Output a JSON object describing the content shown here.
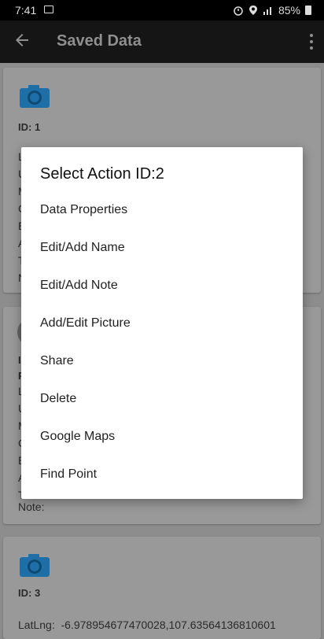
{
  "status_bar": {
    "time": "7:41",
    "battery": "85%"
  },
  "app_bar": {
    "title": "Saved Data"
  },
  "cards": [
    {
      "id_label": "ID: 1"
    },
    {
      "id_label_fragment": "I",
      "p_fragment": "P",
      "note_label": "Note:"
    },
    {
      "id_label": "ID: 3",
      "latlng_label": "LatLng:",
      "latlng_value": "-6.978954677470028,107.63564136810601"
    }
  ],
  "card1_fragments": [
    "L",
    "U",
    "M",
    "C",
    "E",
    "A",
    "T",
    "N"
  ],
  "card2_fragments": [
    "L",
    "U",
    "M",
    "C",
    "E",
    "A",
    "T"
  ],
  "dialog": {
    "title": "Select Action ID:2",
    "items": [
      "Data Properties",
      "Edit/Add Name",
      "Edit/Add Note",
      "Add/Edit Picture",
      "Share",
      "Delete",
      "Google Maps",
      "Find Point"
    ]
  },
  "colors": {
    "camera": "#1e6fa8"
  },
  "icons": [
    "back-arrow-icon",
    "more-vert-icon",
    "camera-icon",
    "image-icon",
    "alarm-icon",
    "location-icon",
    "signal-icon",
    "battery-icon"
  ]
}
